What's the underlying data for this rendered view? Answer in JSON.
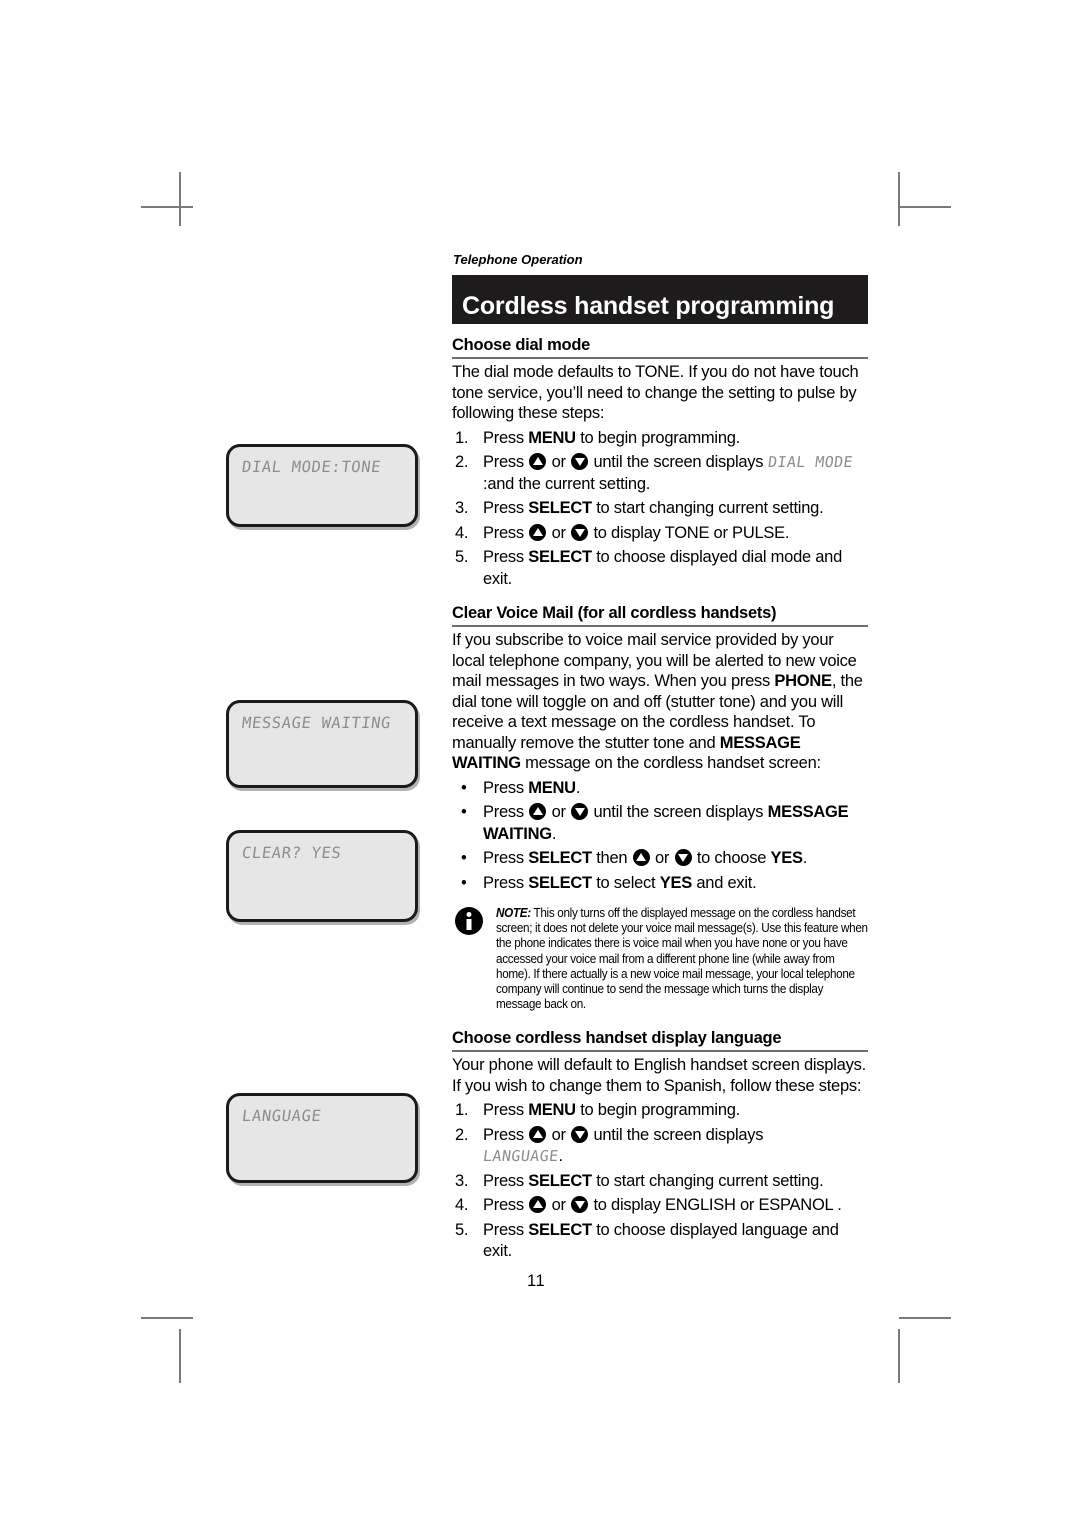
{
  "page": {
    "kicker": "Telephone Operation",
    "title": "Cordless handset programming",
    "page_number": "11"
  },
  "lcd_screens": [
    {
      "name": "dial-mode-screen",
      "text": "DIAL MODE:TONE"
    },
    {
      "name": "message-waiting-screen",
      "text": "MESSAGE WAITING"
    },
    {
      "name": "clear-yes-screen",
      "text": "CLEAR? YES"
    },
    {
      "name": "language-screen",
      "text": "LANGUAGE"
    }
  ],
  "sections": {
    "dial_mode": {
      "heading": "Choose dial mode",
      "intro": "The dial mode defaults to TONE. If you do not have touch tone service, you’ll need to change the setting to pulse by following these steps:",
      "steps": [
        {
          "num": "1.",
          "a": "Press ",
          "bold1": "MENU",
          "b": " to begin programming."
        },
        {
          "num": "2.",
          "a": "Press ",
          "mid": " or ",
          "b": " until the screen displays ",
          "lcd1": "DIAL MODE",
          "c": ":and the current setting."
        },
        {
          "num": "3.",
          "a": "Press ",
          "bold1": "SELECT",
          "b": " to start changing current setting."
        },
        {
          "num": "4.",
          "a": "Press ",
          "mid": " or ",
          "b": " to display TONE or PULSE."
        },
        {
          "num": "5.",
          "a": "Press ",
          "bold1": "SELECT",
          "b": " to choose displayed dial mode and exit."
        }
      ]
    },
    "voice_mail": {
      "heading": "Clear Voice Mail (for all cordless handsets)",
      "intro_1": "If you subscribe to voice mail service provided by your local telephone company, you will be alerted to new voice mail messages in two ways. When you press ",
      "intro_bold_1": "PHONE",
      "intro_2": ", the dial tone will toggle on and off (stutter tone) and you will receive a text message on the cordless handset. To manually remove the stutter tone and ",
      "intro_bold_2": "MESSAGE WAITING",
      "intro_3": " message on the cordless handset screen:",
      "bullets": [
        {
          "a": "Press ",
          "bold1": "MENU",
          "b": "."
        },
        {
          "a": "Press ",
          "mid": " or ",
          "b": " until the screen displays ",
          "bold1": "MESSAGE WAITING",
          "c": "."
        },
        {
          "a": "Press ",
          "bold1": "SELECT",
          "b": " then ",
          "mid": " or ",
          "c": " to choose ",
          "bold2": "YES",
          "d": "."
        },
        {
          "a": "Press ",
          "bold1": "SELECT",
          "b": " to select ",
          "bold2": "YES",
          "c": " and exit."
        }
      ],
      "note_label": "NOTE:",
      "note_text": " This only turns off the displayed message on the cordless handset screen; it does not delete your voice mail message(s). Use this feature when the phone indicates there is voice mail when you have none or you have accessed your voice mail from a different phone line (while away from home). If there actually is a new voice mail message, your local telephone company will continue to send the message which turns the display message back on."
    },
    "language": {
      "heading": "Choose cordless handset display language",
      "intro": "Your phone will default to English handset screen displays. If you wish to change them to Spanish, follow these steps:",
      "steps": [
        {
          "num": "1.",
          "a": "Press ",
          "bold1": "MENU",
          "b": " to begin programming."
        },
        {
          "num": "2.",
          "a": "Press ",
          "mid": " or ",
          "b": " until the screen displays ",
          "lcd1": "LANGUAGE",
          "c": "."
        },
        {
          "num": "3.",
          "a": "Press ",
          "bold1": "SELECT",
          "b": " to start changing current setting."
        },
        {
          "num": "4.",
          "a": "Press ",
          "mid": " or ",
          "b": " to display ENGLISH or ESPANOL ."
        },
        {
          "num": "5.",
          "a": "Press ",
          "bold1": "SELECT",
          "b": " to choose displayed language and exit."
        }
      ]
    }
  },
  "icons": {
    "up_key": "up-arrow-key-icon",
    "down_key": "down-arrow-key-icon",
    "info": "info-icon"
  },
  "colors": {
    "title_bar_bg": "#1d1b1b",
    "title_bar_text": "#ffffff",
    "lcd_bg": "#e6e6e6",
    "lcd_text": "#8c8c92",
    "rule": "#6e6e6e",
    "crop_mark": "#7a7a7a"
  }
}
